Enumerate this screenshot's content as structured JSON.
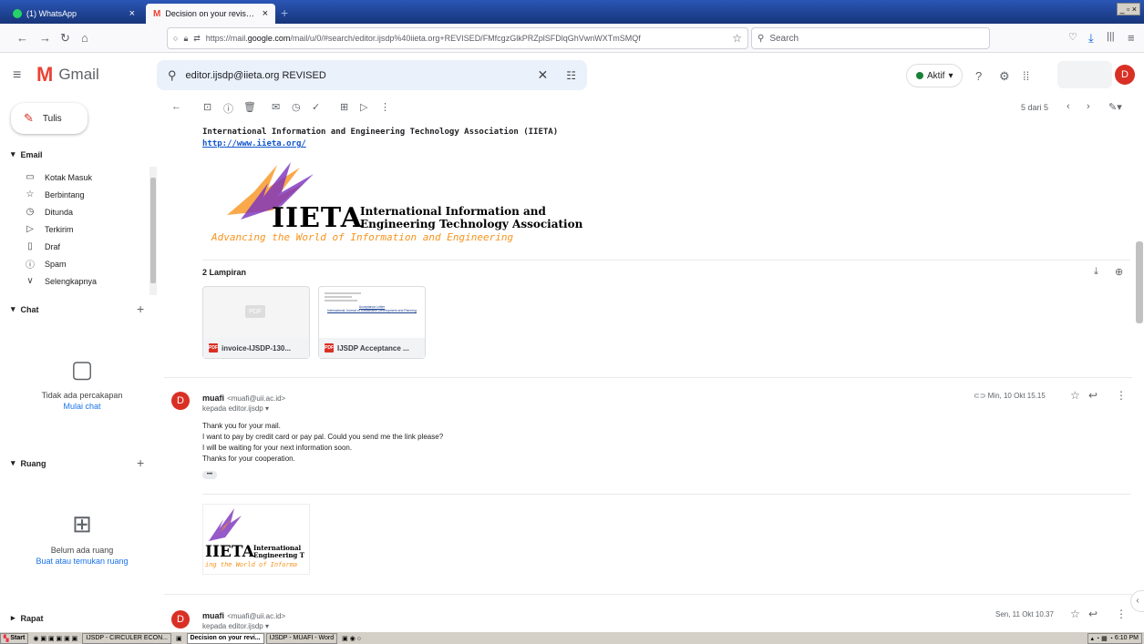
{
  "browser": {
    "tabs": [
      {
        "label": "(1) WhatsApp"
      },
      {
        "label": "Decision on your revised paper su..."
      }
    ],
    "url_prefix": "https://mail.",
    "url_domain": "google.com",
    "url_rest": "/mail/u/0/#search/editor.ijsdp%40iieta.org+REVISED/FMfcgzGlkPRZplSFDlqGhVwnWXTmSMQf",
    "search_placeholder": "Search"
  },
  "gmail": {
    "brand": "Gmail",
    "search_query": "editor.ijsdp@iieta.org REVISED",
    "status": "Aktif",
    "avatar": "D"
  },
  "sidebar": {
    "compose": "Tulis",
    "email_section": "Email",
    "items": [
      {
        "label": "Kotak Masuk",
        "icon": "inbox-icon"
      },
      {
        "label": "Berbintang",
        "icon": "star-icon"
      },
      {
        "label": "Ditunda",
        "icon": "clock-icon"
      },
      {
        "label": "Terkirim",
        "icon": "send-icon"
      },
      {
        "label": "Draf",
        "icon": "draft-icon"
      },
      {
        "label": "Spam",
        "icon": "spam-icon"
      },
      {
        "label": "Selengkapnya",
        "icon": "chevron-down-icon"
      }
    ],
    "chat_section": "Chat",
    "chat_empty": "Tidak ada percakapan",
    "chat_start": "Mulai chat",
    "room_section": "Ruang",
    "room_empty": "Belum ada ruang",
    "room_link": "Buat atau temukan ruang",
    "meet_section": "Rapat"
  },
  "toolbar": {
    "pager": "5 dari 5"
  },
  "email": {
    "assoc_name": "International Information and Engineering Technology Association (IIETA)",
    "assoc_link": "http://www.iieta.org/",
    "logo_brand": "IIETA",
    "logo_line1": "International Information and",
    "logo_line2": "Engineering Technology Association",
    "logo_tagline": "Advancing the World of Information and Engineering",
    "attachments_title": "2 Lampiran",
    "attachments": [
      {
        "name": "invoice-IJSDP-130..."
      },
      {
        "name": "IJSDP Acceptance ..."
      }
    ],
    "attachment_thumb_title": "Acceptance Letter",
    "attachment_thumb_sub": "International Journal of Sustainable Development and Planning",
    "messages": [
      {
        "avatar": "D",
        "sender": "muafi",
        "email": "<muafi@uii.ac.id>",
        "to": "kepada editor.ijsdp",
        "date": "Min, 10 Okt 15.15",
        "lines": [
          "Thank you for your mail.",
          "I want to pay by credit card or pay pal. Could you send me the link please?",
          "I will be waiting for your next information soon.",
          "Thanks for your cooperation."
        ],
        "ellipsis": "•••",
        "logo_brand": "IIETA",
        "logo_line1": "International",
        "logo_line2": "Engineering T",
        "logo_tagline": "ing the World of Informa"
      },
      {
        "avatar": "D",
        "sender": "muafi",
        "email": "<muafi@uii.ac.id>",
        "to": "kepada editor.ijsdp",
        "date": "Sen, 11 Okt 10.37"
      }
    ]
  },
  "taskbar": {
    "start": "Start",
    "items": [
      "IJSDP - CIRCULER ECON...",
      "Decision on your revi...",
      "IJSDP - MUAFI - Word"
    ],
    "clock": "6:10 PM"
  }
}
